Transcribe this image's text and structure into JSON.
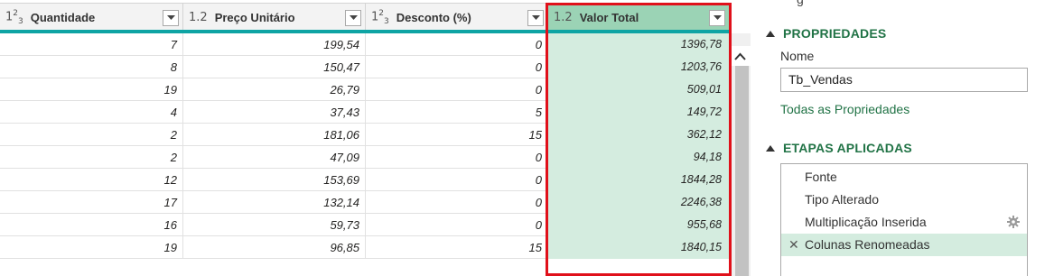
{
  "grid": {
    "columns": [
      {
        "type_icon": "123",
        "name": "Quantidade"
      },
      {
        "type_icon": "1.2",
        "name": "Preço Unitário"
      },
      {
        "type_icon": "123",
        "name": "Desconto (%)"
      },
      {
        "type_icon": "1.2",
        "name": "Valor Total",
        "selected": true
      }
    ],
    "rows": [
      {
        "qtd": "7",
        "preco": "199,54",
        "desc": "0",
        "total": "1396,78"
      },
      {
        "qtd": "8",
        "preco": "150,47",
        "desc": "0",
        "total": "1203,76"
      },
      {
        "qtd": "19",
        "preco": "26,79",
        "desc": "0",
        "total": "509,01"
      },
      {
        "qtd": "4",
        "preco": "37,43",
        "desc": "5",
        "total": "149,72"
      },
      {
        "qtd": "2",
        "preco": "181,06",
        "desc": "15",
        "total": "362,12"
      },
      {
        "qtd": "2",
        "preco": "47,09",
        "desc": "0",
        "total": "94,18"
      },
      {
        "qtd": "12",
        "preco": "153,69",
        "desc": "0",
        "total": "1844,28"
      },
      {
        "qtd": "17",
        "preco": "132,14",
        "desc": "0",
        "total": "2246,38"
      },
      {
        "qtd": "16",
        "preco": "59,73",
        "desc": "0",
        "total": "955,68"
      },
      {
        "qtd": "19",
        "preco": "96,85",
        "desc": "15",
        "total": "1840,15"
      }
    ]
  },
  "panel": {
    "top_cut_text": "g",
    "properties_title": "PROPRIEDADES",
    "name_label": "Nome",
    "name_value": "Tb_Vendas",
    "all_properties_link": "Todas as Propriedades",
    "steps_title": "ETAPAS APLICADAS",
    "steps": [
      {
        "label": "Fonte"
      },
      {
        "label": "Tipo Alterado"
      },
      {
        "label": "Multiplicação Inserida",
        "has_gear": true
      },
      {
        "label": "Colunas Renomeadas",
        "active": true,
        "deletable": true
      }
    ]
  },
  "colors": {
    "accent_green": "#217346",
    "selected_header": "#9bd3b5",
    "selected_cells": "#d4ecdf",
    "teal_line": "#0ea4a4",
    "highlight_box": "#e0101a"
  }
}
